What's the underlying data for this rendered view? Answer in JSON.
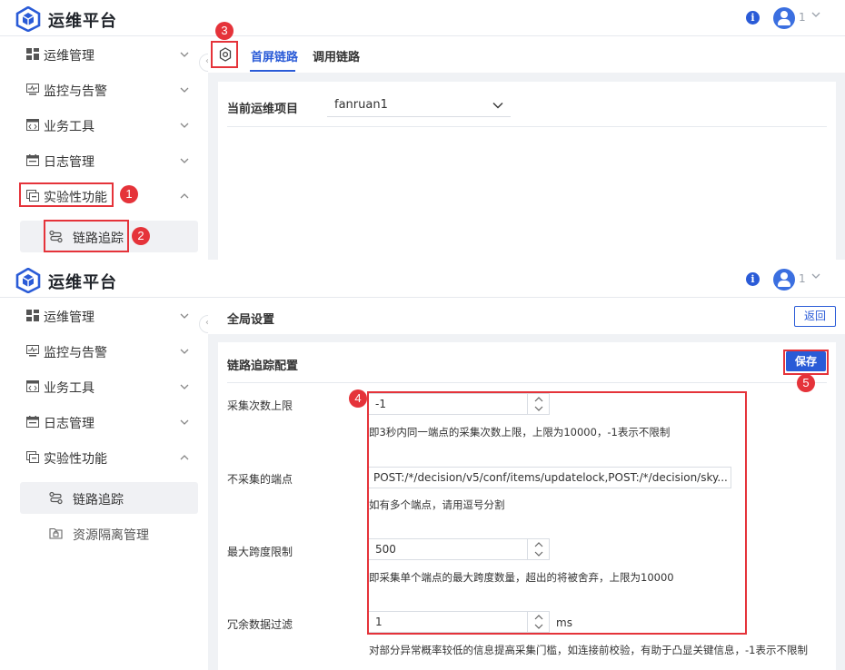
{
  "app": {
    "title": "运维平台",
    "user_number": "1"
  },
  "sidebar": {
    "items": [
      {
        "label": "运维管理",
        "icon": "dashboard-icon"
      },
      {
        "label": "监控与告警",
        "icon": "monitor-icon"
      },
      {
        "label": "业务工具",
        "icon": "code-icon"
      },
      {
        "label": "日志管理",
        "icon": "calendar-icon"
      },
      {
        "label": "实验性功能",
        "icon": "experiment-icon"
      }
    ],
    "sub_items": [
      {
        "label": "链路追踪",
        "icon": "trace-icon"
      },
      {
        "label": "资源隔离管理",
        "icon": "resource-icon"
      }
    ]
  },
  "top_screen": {
    "tabs": [
      {
        "label": "首屏链路",
        "active": true
      },
      {
        "label": "调用链路",
        "active": false
      }
    ],
    "project_label": "当前运维项目",
    "project_value": "fanruan1"
  },
  "bottom_screen": {
    "header_title": "全局设置",
    "back_label": "返回",
    "config_title": "链路追踪配置",
    "save_label": "保存",
    "fields": [
      {
        "label": "采集次数上限",
        "value": "-1",
        "hint": "即3秒内同一端点的采集次数上限，上限为10000，-1表示不限制"
      },
      {
        "label": "不采集的端点",
        "value": "POST:/*/decision/v5/conf/items/updatelock,POST:/*/decision/sky...",
        "hint": "如有多个端点，请用逗号分割"
      },
      {
        "label": "最大跨度限制",
        "value": "500",
        "hint": "即采集单个端点的最大跨度数量，超出的将被舍弃，上限为10000"
      },
      {
        "label": "冗余数据过滤",
        "value": "1",
        "unit": "ms",
        "hint": "对部分异常概率较低的信息提高采集门槛，如连接前校验，有助于凸显关键信息，-1表示不限制"
      }
    ]
  },
  "annotations": [
    "1",
    "2",
    "3",
    "4",
    "5"
  ],
  "colors": {
    "accent": "#2a5bd7",
    "annotation": "#e5333a",
    "background": "#f0f2f5"
  }
}
